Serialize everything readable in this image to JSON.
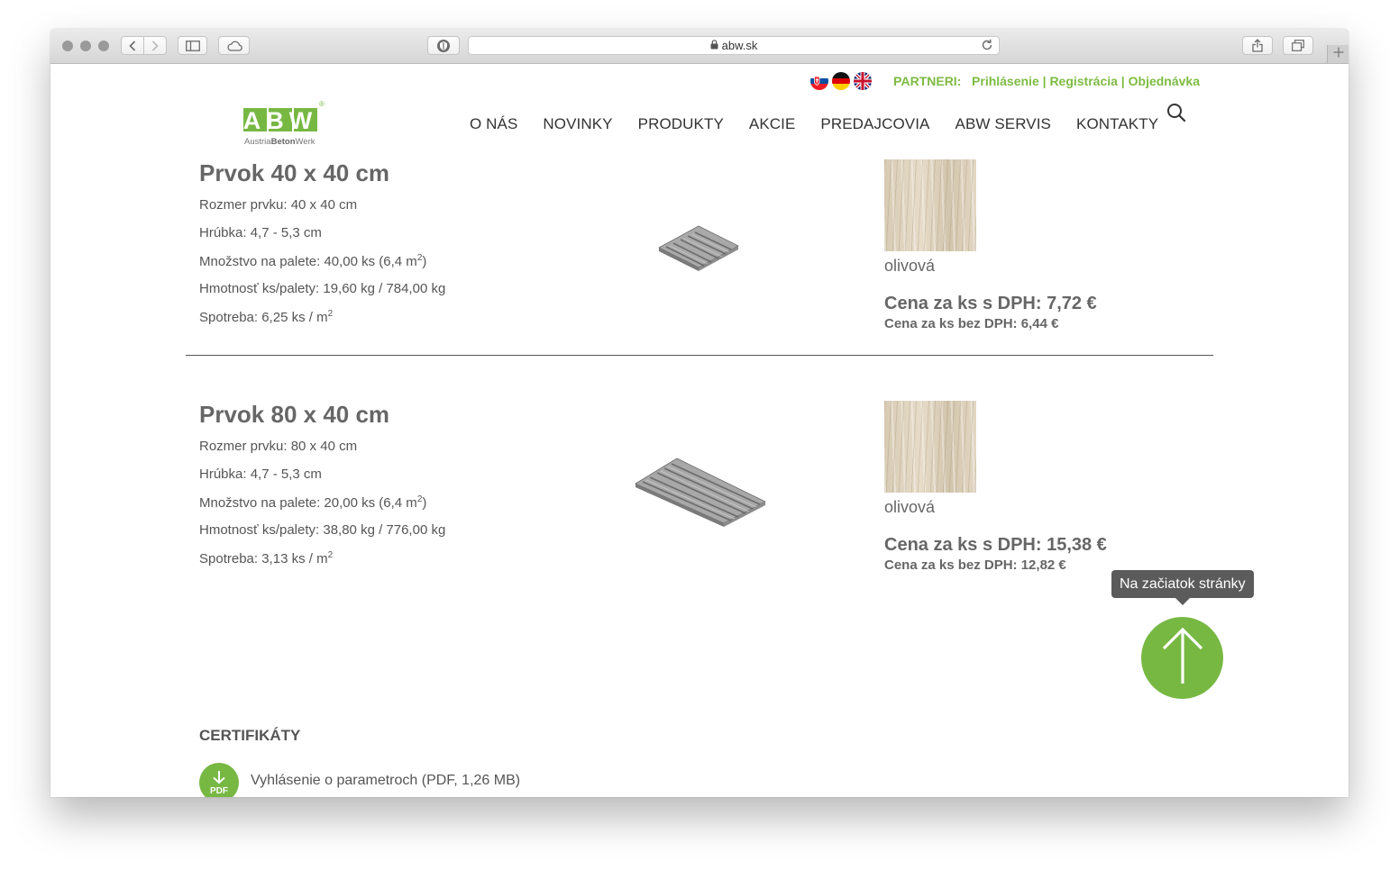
{
  "browser": {
    "url": "abw.sk",
    "icons": [
      "back-icon",
      "forward-icon",
      "sidebar-icon",
      "icloud-icon",
      "privacy-icon",
      "lock-icon",
      "reload-icon",
      "share-icon",
      "tabs-icon",
      "new-tab-icon"
    ]
  },
  "header": {
    "languages": [
      "Slovak",
      "German",
      "English"
    ],
    "partneri_label": "PARTNERI:",
    "links": [
      "Prihlásenie",
      "Registrácia",
      "Objednávka"
    ],
    "separator": " | ",
    "logo_letters": "ABW",
    "logo_sub_1": "Austria",
    "logo_sub_2": "Beton",
    "logo_sub_3": "Werk",
    "logo_reg": "®"
  },
  "nav": {
    "items": [
      "O NÁS",
      "NOVINKY",
      "PRODUKTY",
      "AKCIE",
      "PREDAJCOVIA",
      "ABW SERVIS",
      "KONTAKTY"
    ]
  },
  "products": [
    {
      "title": "Prvok 40 x 40 cm",
      "specs": [
        {
          "label": "Rozmer prvku:",
          "value": "40 x 40 cm",
          "sup": "",
          "after": ""
        },
        {
          "label": "Hrúbka:",
          "value": "4,7 - 5,3 cm",
          "sup": "",
          "after": ""
        },
        {
          "label": "Množstvo na palete:",
          "value": "40,00 ks (6,4 m",
          "sup": "2",
          "after": ")"
        },
        {
          "label": "Hmotnosť ks/palety:",
          "value": "19,60 kg / 784,00 kg",
          "sup": "",
          "after": ""
        },
        {
          "label": "Spotreba:",
          "value": "6,25 ks / m",
          "sup": "2",
          "after": ""
        }
      ],
      "color": "olivová",
      "price": "Cena za ks s DPH: 7,72 €",
      "price_nodph": "Cena za ks bez DPH: 6,44 €"
    },
    {
      "title": "Prvok 80 x 40 cm",
      "specs": [
        {
          "label": "Rozmer prvku:",
          "value": "80 x 40 cm",
          "sup": "",
          "after": ""
        },
        {
          "label": "Hrúbka:",
          "value": "4,7 - 5,3 cm",
          "sup": "",
          "after": ""
        },
        {
          "label": "Množstvo na palete:",
          "value": "20,00 ks (6,4 m",
          "sup": "2",
          "after": ")"
        },
        {
          "label": "Hmotnosť ks/palety:",
          "value": "38,80 kg / 776,00 kg",
          "sup": "",
          "after": ""
        },
        {
          "label": "Spotreba:",
          "value": "3,13 ks / m",
          "sup": "2",
          "after": ""
        }
      ],
      "color": "olivová",
      "price": "Cena za ks s DPH: 15,38 €",
      "price_nodph": "Cena za ks bez DPH: 12,82 €"
    }
  ],
  "back_to_top": {
    "tooltip": "Na začiatok stránky"
  },
  "certificates": {
    "title": "CERTIFIKÁTY",
    "pdf_badge": "PDF",
    "link": "Vyhlásenie o parametroch (PDF, 1,26 MB)"
  },
  "colors": {
    "brand_green": "#77b843",
    "link_green": "#7dbb42",
    "text_gray": "#666666"
  }
}
